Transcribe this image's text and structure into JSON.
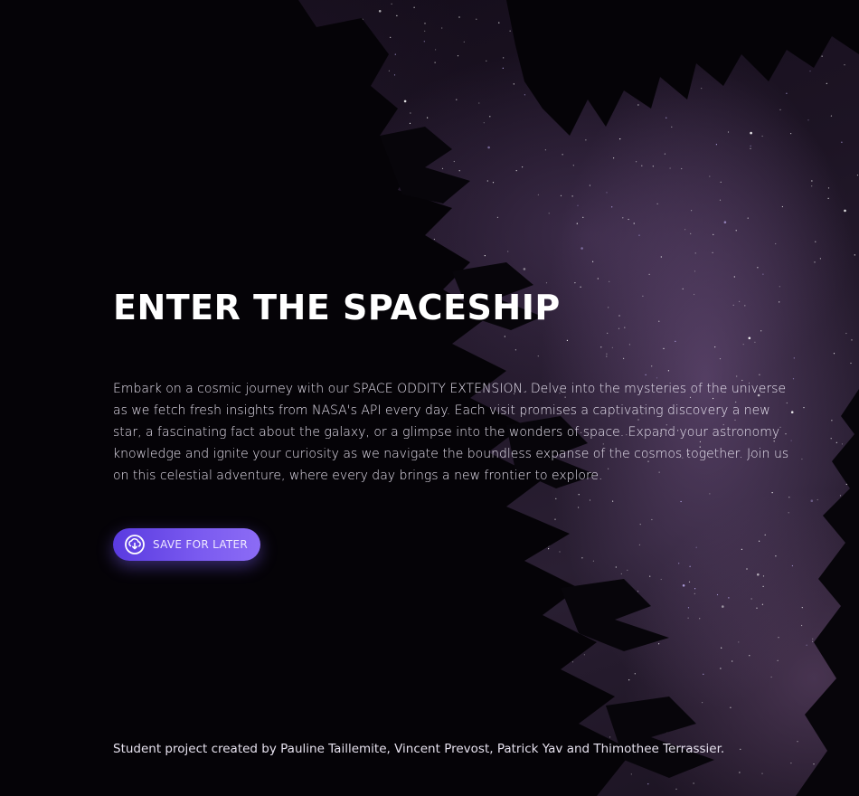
{
  "hero": {
    "title": "ENTER THE SPACESHIP",
    "description": "Embark on a cosmic journey with our SPACE ODDITY EXTENSION. Delve into the mysteries of the universe as we fetch fresh insights from NASA's API every day. Each visit promises a captivating discovery a new star, a fascinating fact about the galaxy, or a glimpse into the wonders of space. Expand your astronomy knowledge and ignite your curiosity as we navigate the boundless expanse of the cosmos together. Join us on this celestial adventure, where every day brings a new frontier to explore."
  },
  "actions": {
    "save_label": "SAVE FOR LATER",
    "save_icon": "cloud-download-icon"
  },
  "footer": {
    "credits": "Student project created by Pauline Taillemite, Vincent Prevost, Patrick Yav and Thimothee Terrassier."
  },
  "colors": {
    "button_start": "#5a3be0",
    "button_end": "#8c6cf5",
    "text": "#ffffff"
  }
}
